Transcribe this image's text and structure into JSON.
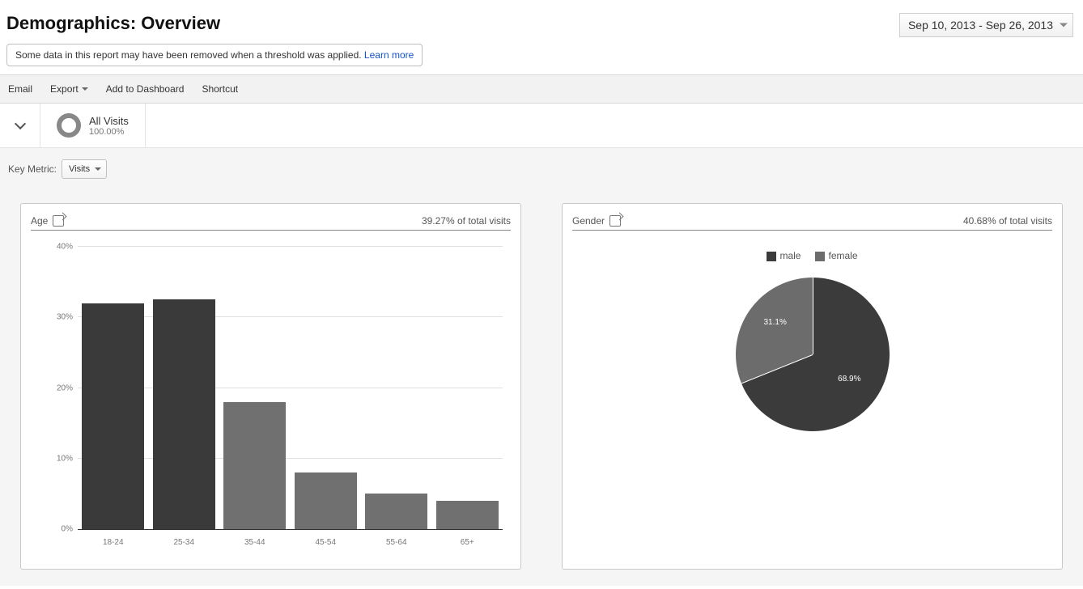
{
  "header": {
    "title": "Demographics: Overview",
    "date_range": "Sep 10, 2013 - Sep 26, 2013",
    "notice_text": "Some data in this report may have been removed when a threshold was applied. ",
    "notice_link": "Learn more"
  },
  "toolbar": {
    "email": "Email",
    "export": "Export",
    "add_dashboard": "Add to Dashboard",
    "shortcut": "Shortcut"
  },
  "segment": {
    "name": "All Visits",
    "percent": "100.00%"
  },
  "key_metric": {
    "label": "Key Metric:",
    "value": "Visits"
  },
  "panels": {
    "age": {
      "title": "Age",
      "subtitle": "39.27% of total visits"
    },
    "gender": {
      "title": "Gender",
      "subtitle": "40.68% of total visits",
      "legend_male": "male",
      "legend_female": "female",
      "male_pct": "68.9%",
      "female_pct": "31.1%"
    }
  },
  "chart_data": [
    {
      "id": "age",
      "type": "bar",
      "title": "Age",
      "xlabel": "",
      "ylabel": "",
      "ylim": [
        0,
        40
      ],
      "yticks": [
        0,
        10,
        20,
        30,
        40
      ],
      "categories": [
        "18-24",
        "25-34",
        "35-44",
        "45-54",
        "55-64",
        "65+"
      ],
      "values": [
        32,
        32.5,
        18,
        8,
        5,
        4
      ],
      "unit": "%",
      "highlight_indices": [
        0,
        1
      ]
    },
    {
      "id": "gender",
      "type": "pie",
      "title": "Gender",
      "series": [
        {
          "name": "male",
          "value": 68.9,
          "color": "#3b3b3b"
        },
        {
          "name": "female",
          "value": 31.1,
          "color": "#6c6c6c"
        }
      ],
      "unit": "%"
    }
  ]
}
